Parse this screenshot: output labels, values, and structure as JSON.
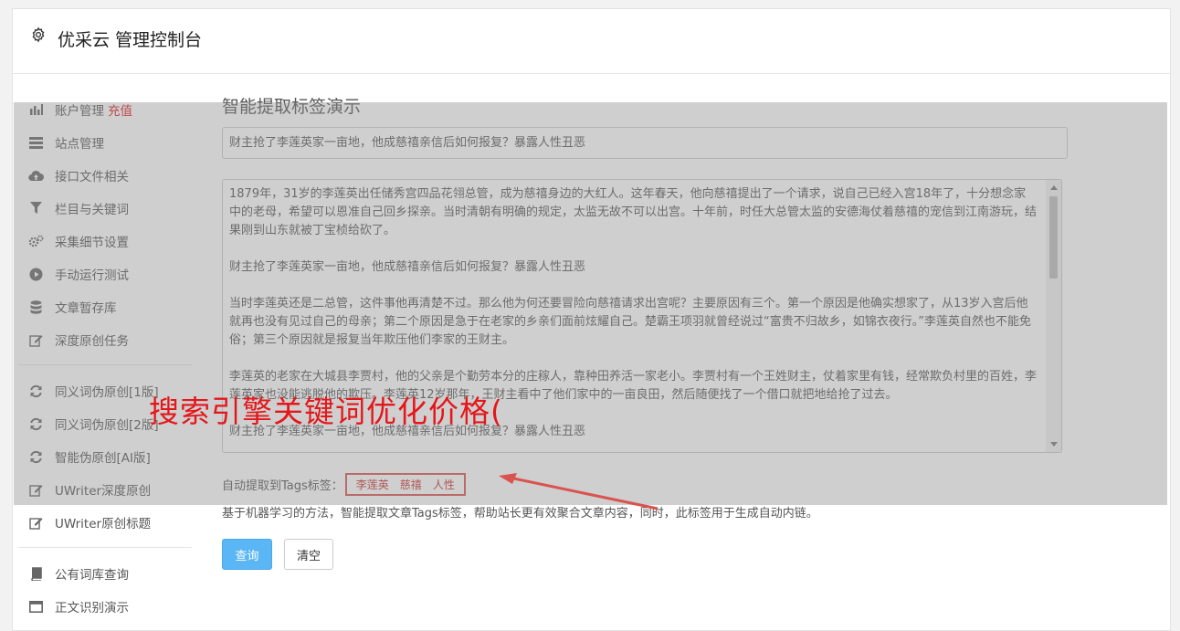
{
  "header": {
    "icon": "gear-icon",
    "title": "优采云 管理控制台"
  },
  "sidebar": {
    "items": [
      {
        "label": "账户管理",
        "badge": "充值",
        "icon": "bar-chart-icon"
      },
      {
        "label": "站点管理",
        "icon": "list-icon"
      },
      {
        "label": "接口文件相关",
        "icon": "cloud-upload-icon"
      },
      {
        "label": "栏目与关键词",
        "icon": "filter-icon"
      },
      {
        "label": "采集细节设置",
        "icon": "cogs-icon"
      },
      {
        "label": "手动运行测试",
        "icon": "play-circle-icon"
      },
      {
        "label": "文章暂存库",
        "icon": "database-icon"
      },
      {
        "label": "深度原创任务",
        "icon": "edit-icon"
      },
      {
        "label": "同义词伪原创[1版]",
        "icon": "refresh-icon"
      },
      {
        "label": "同义词伪原创[2版]",
        "icon": "refresh-icon"
      },
      {
        "label": "智能伪原创[AI版]",
        "icon": "refresh-icon"
      },
      {
        "label": "UWriter深度原创",
        "icon": "edit-icon"
      },
      {
        "label": "UWriter原创标题",
        "icon": "edit-icon"
      },
      {
        "label": "公有词库查询",
        "icon": "book-icon"
      },
      {
        "label": "正文识别演示",
        "icon": "window-icon"
      }
    ]
  },
  "main": {
    "demo_title": "智能提取标签演示",
    "title_value": "财主抢了李莲英家一亩地，他成慈禧亲信后如何报复？暴露人性丑恶",
    "content_paragraphs": [
      "1879年，31岁的李莲英出任储秀宫四品花翎总管，成为慈禧身边的大红人。这年春天，他向慈禧提出了一个请求，说自己已经入宫18年了，十分想念家中的老母，希望可以恩准自己回乡探亲。当时清朝有明确的规定，太监无故不可以出宫。十年前，时任大总管太监的安德海仗着慈禧的宠信到江南游玩，结果刚到山东就被丁宝桢给砍了。",
      "财主抢了李莲英家一亩地，他成慈禧亲信后如何报复？暴露人性丑恶",
      "当时李莲英还是二总管，这件事他再清楚不过。那么他为何还要冒险向慈禧请求出宫呢？主要原因有三个。第一个原因是他确实想家了，从13岁入宫后他就再也没有见过自己的母亲；第二个原因是急于在老家的乡亲们面前炫耀自己。楚霸王项羽就曾经说过“富贵不归故乡，如锦衣夜行。”李莲英自然也不能免俗；第三个原因就是报复当年欺压他们李家的王财主。",
      "李莲英的老家在大城县李贾村，他的父亲是个勤劳本分的庄稼人，靠种田养活一家老小。李贾村有一个王姓财主，仗着家里有钱，经常欺负村里的百姓，李莲英家也没能逃脱他的欺压。李莲英12岁那年，王财主看中了他们家中的一亩良田，然后随便找了一个借口就把地给抢了过去。",
      "财主抢了李莲英家一亩地，他成慈禧亲信后如何报复？暴露人性丑恶"
    ],
    "tags_label": "自动提取到Tags标签：",
    "tags": [
      "李莲英",
      "慈禧",
      "人性"
    ],
    "description": "基于机器学习的方法，智能提取文章Tags标签，帮助站长更有效聚合文章内容，同时，此标签用于生成自动内链。",
    "query_button": "查询",
    "clear_button": "清空"
  },
  "overlay_text": "搜索引擎关键词优化价格(",
  "colors": {
    "accent_blue": "#5bb6f5",
    "tag_red": "#c9302c",
    "overlay_red": "#e4171b"
  }
}
